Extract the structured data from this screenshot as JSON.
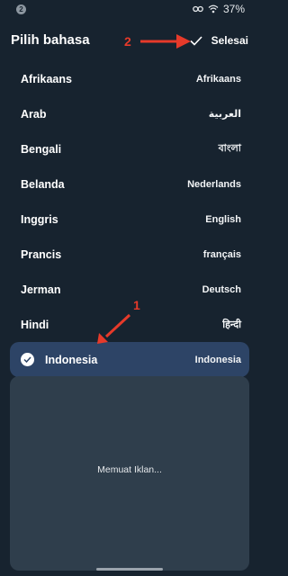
{
  "status": {
    "notification_badge": "2",
    "battery_percent": "37%"
  },
  "header": {
    "title": "Pilih bahasa",
    "done_label": "Selesai"
  },
  "languages": [
    {
      "name": "Afrikaans",
      "native": "Afrikaans"
    },
    {
      "name": "Arab",
      "native": "العربية"
    },
    {
      "name": "Bengali",
      "native": "বাংলা"
    },
    {
      "name": "Belanda",
      "native": "Nederlands"
    },
    {
      "name": "Inggris",
      "native": "English"
    },
    {
      "name": "Prancis",
      "native": "français"
    },
    {
      "name": "Jerman",
      "native": "Deutsch"
    },
    {
      "name": "Hindi",
      "native": "हिन्दी"
    }
  ],
  "selected_language": {
    "name": "Indonesia",
    "native": "Indonesia"
  },
  "ad": {
    "loading_text": "Memuat Iklan..."
  },
  "annotations": {
    "label_1": "1",
    "label_2": "2"
  },
  "colors": {
    "background": "#17232f",
    "selected_row": "#2d4466",
    "ad_panel": "#2f3e4c",
    "annotation": "#e63a2a"
  }
}
